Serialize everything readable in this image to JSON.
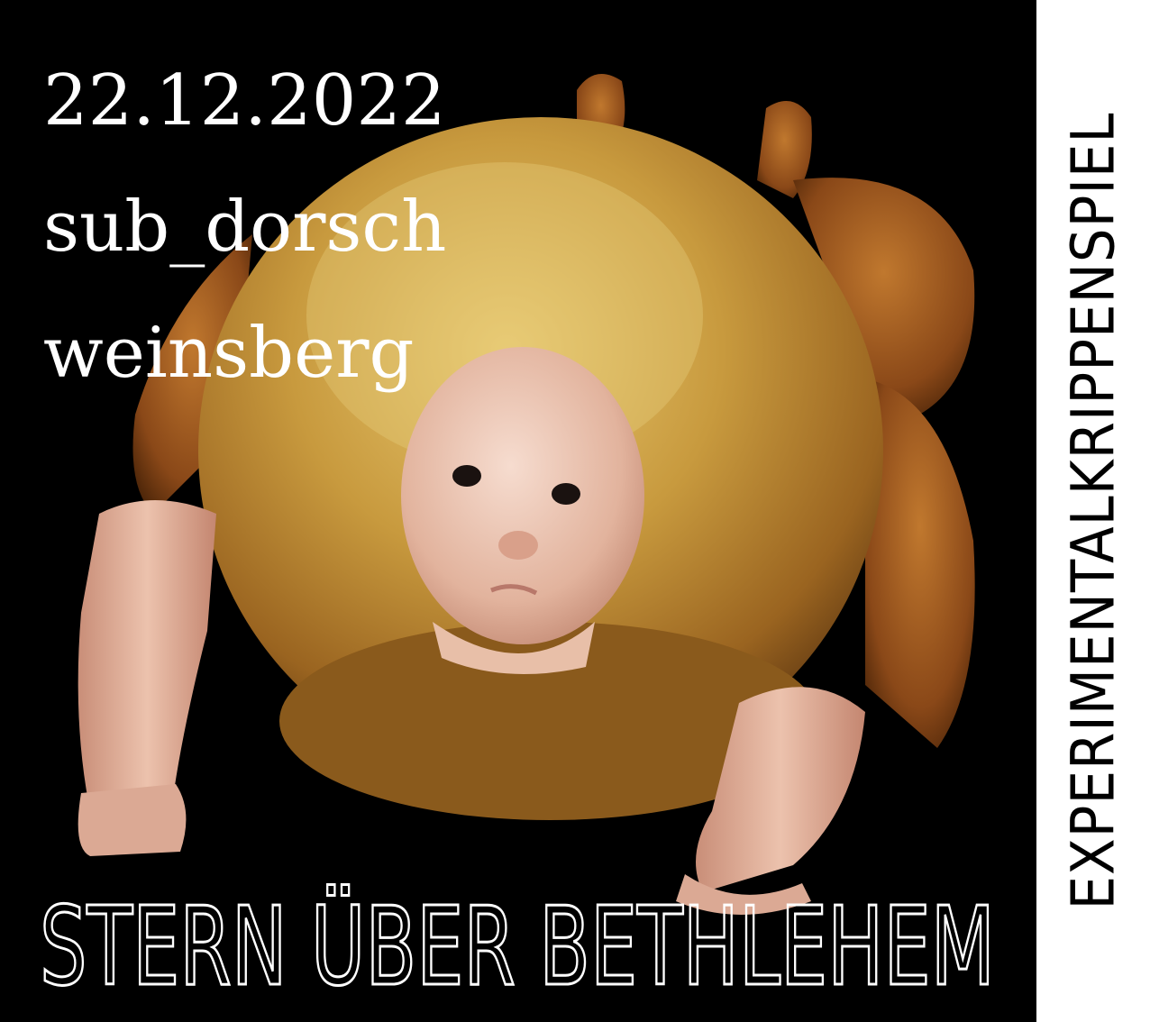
{
  "event": {
    "date": "22.12.2022",
    "venue": "sub_dorsch",
    "city": "weinsberg"
  },
  "headline": "STERN ÜBER BETHLEHEM",
  "sidebar_title": "EXPERIMENTALKRIPPENSPIEL",
  "colors": {
    "background": "#000000",
    "sidebar": "#ffffff",
    "text": "#ffffff"
  }
}
